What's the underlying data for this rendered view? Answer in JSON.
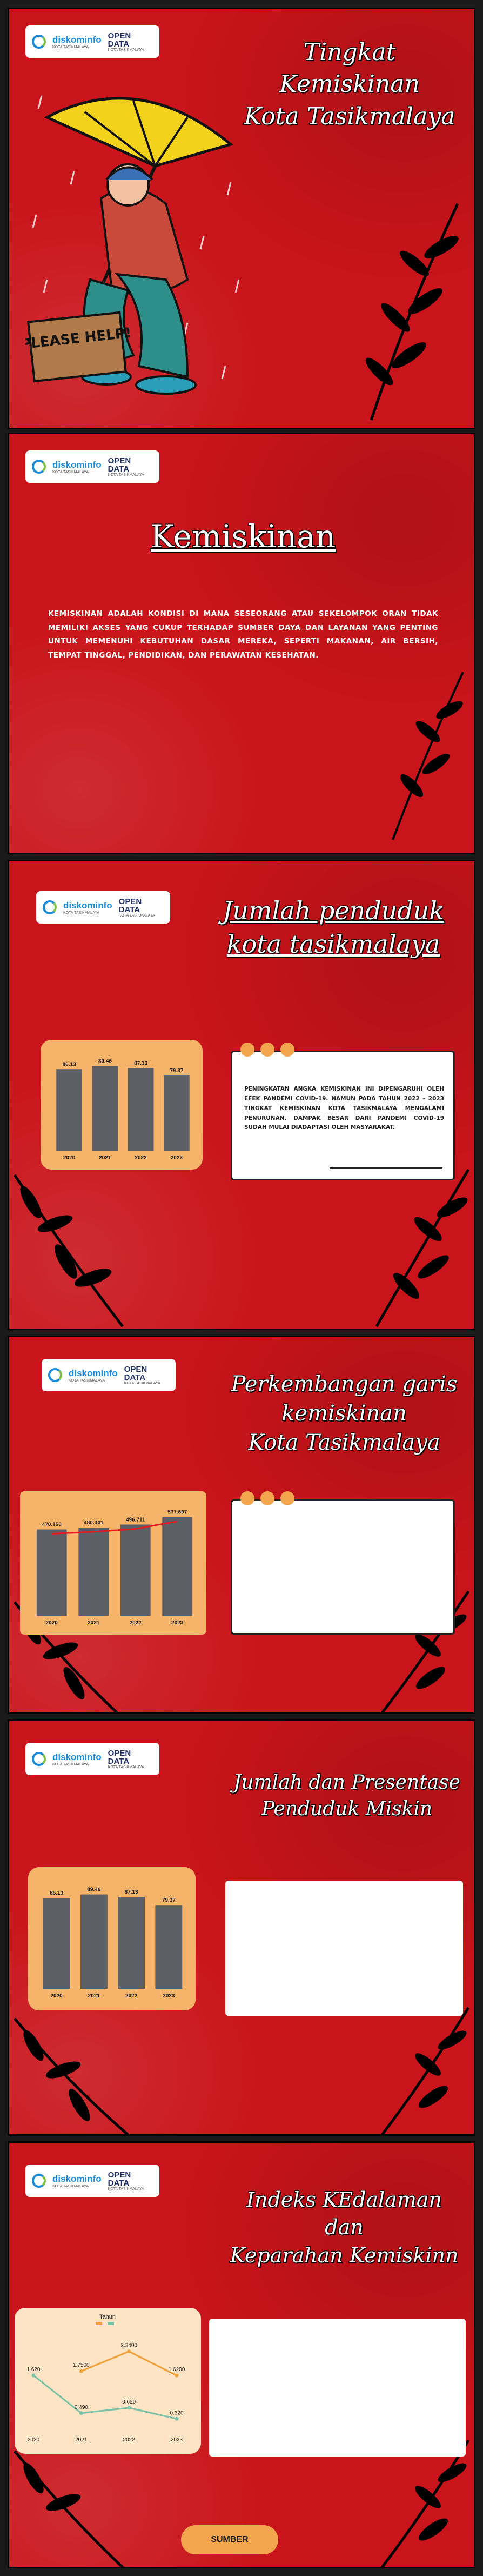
{
  "logo": {
    "brand_a": "diskominfo",
    "brand_a_sub": "KOTA TASIKMALAYA",
    "brand_b": "OPEN DATA",
    "brand_b_sub": "KOTA TASIKMALAYA"
  },
  "illustration": {
    "sign": "PLEASE HELP!"
  },
  "panel1": {
    "title_line1": "Tingkat Kemiskinan",
    "title_line2": "Kota Tasikmalaya"
  },
  "panel2": {
    "title": "Kemiskinan",
    "body": "KEMISKINAN ADALAH KONDISI DI MANA SESEORANG ATAU SEKELOMPOK ORAN TIDAK MEMILIKI AKSES YANG CUKUP TERHADAP SUMBER DAYA DAN LAYANAN YANG PENTING UNTUK MEMENUHI KEBUTUHAN DASAR MEREKA, SEPERTI MAKANAN, AIR BERSIH, TEMPAT TINGGAL, PENDIDIKAN, DAN PERAWATAN KESEHATAN."
  },
  "panel3": {
    "title_line1": "Jumlah penduduk",
    "title_line2": "kota tasikmalaya",
    "info": "PENINGKATAN ANGKA KEMISKINAN INI DIPENGARUHI OLEH EFEK PANDEMI COVID-19. NAMUN PADA TAHUN 2022 - 2023 TINGKAT KEMISKINAN KOTA TASIKMALAYA MENGALAMI PENURUNAN. DAMPAK BESAR DARI PANDEMI COVID-19 SUDAH MULAI DIADAPTASI OLEH MASYARAKAT."
  },
  "panel4": {
    "title_line1": "Perkembangan garis",
    "title_line2": "kemiskinan",
    "title_line3": "Kota Tasikmalaya",
    "info": ""
  },
  "panel5": {
    "title_line1": "Jumlah dan Presentase",
    "title_line2": "Penduduk Miskin",
    "info": ""
  },
  "panel6": {
    "title_line1": "Indeks KEdalaman dan",
    "title_line2": "Keparahan Kemiskinn",
    "info": ""
  },
  "footer": {
    "sumber": "SUMBER"
  },
  "chart_data": [
    {
      "type": "bar",
      "categories": [
        "2020",
        "2021",
        "2022",
        "2023"
      ],
      "values": [
        86.13,
        89.46,
        87.13,
        79.37
      ],
      "labels": [
        "86.13",
        "89.46",
        "87.13",
        "79.37"
      ],
      "ylim": [
        0,
        100
      ]
    },
    {
      "type": "bar",
      "categories": [
        "2020",
        "2021",
        "2022",
        "2023"
      ],
      "values": [
        470150,
        480341,
        496711,
        537697
      ],
      "labels": [
        "470.150",
        "480.341",
        "496.711",
        "537.697"
      ],
      "ylim": [
        0,
        560000
      ],
      "trend_line": true
    },
    {
      "type": "bar",
      "categories": [
        "2020",
        "2021",
        "2022",
        "2023"
      ],
      "values": [
        86.13,
        89.46,
        87.13,
        79.37
      ],
      "labels": [
        "86.13",
        "89.46",
        "87.13",
        "79.37"
      ],
      "ylim": [
        0,
        100
      ]
    },
    {
      "type": "line",
      "legend_title": "Tahun",
      "categories": [
        "2020",
        "2021",
        "2022",
        "2023"
      ],
      "series": [
        {
          "values": [
            1.75,
            2.34,
            1.62
          ],
          "labels": [
            "1.7500",
            "2.3400",
            "1.6200"
          ],
          "x": [
            "2021",
            "2022",
            "2023"
          ]
        },
        {
          "values": [
            1.62,
            0.49,
            0.65,
            0.32
          ],
          "labels": [
            "1.620",
            "0.490",
            "0.650",
            "0.320"
          ]
        }
      ],
      "ylim": [
        0,
        3
      ]
    }
  ],
  "colors": {
    "panel": "#c8141a",
    "card": "#f6b46a",
    "bar": "#5c5f66",
    "accent": "#f4a64e"
  }
}
